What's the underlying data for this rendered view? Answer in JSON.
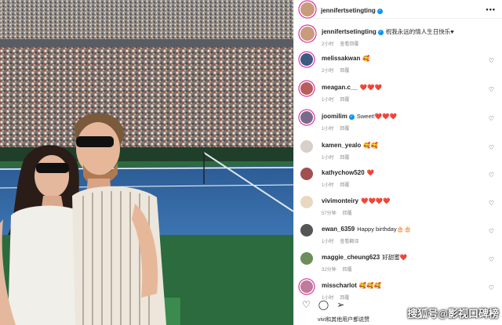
{
  "post": {
    "author": "jennifertsetingting",
    "caption": "祝我永远的情人生日快乐♥",
    "caption_time": "2小时",
    "caption_action": "查看回覆"
  },
  "comments": [
    {
      "user": "melissakwan",
      "text": "🥰",
      "time": "2小时",
      "reply": "回覆",
      "verified": false,
      "avatar_color": "#3d5a80"
    },
    {
      "user": "meagan.c__",
      "text": "❤️❤️❤️",
      "time": "1小时",
      "reply": "回覆",
      "verified": false,
      "avatar_color": "#b85c5c"
    },
    {
      "user": "joomilim",
      "text": "Sweet!❤️❤️❤️",
      "time": "1小时",
      "reply": "回覆",
      "verified": true,
      "avatar_color": "#7a6a8a"
    },
    {
      "user": "kamen_yealo",
      "text": "🥰🥰",
      "time": "1小时",
      "reply": "回覆",
      "verified": false,
      "avatar_color": "#d8d0c8"
    },
    {
      "user": "kathychow520",
      "text": "❤️",
      "time": "1小时",
      "reply": "回覆",
      "verified": false,
      "avatar_color": "#a05050"
    },
    {
      "user": "vivimonteiry",
      "text": "❤️❤️❤️❤️",
      "time": "57分钟",
      "reply": "回覆",
      "verified": false,
      "avatar_color": "#e8d8c0"
    },
    {
      "user": "ewan_6359",
      "text": "Happy birthday🎂🎂",
      "time": "1小时",
      "reply": "查看翻译",
      "verified": false,
      "avatar_color": "#555555"
    },
    {
      "user": "maggie_cheung623",
      "text": "好甜蜜❤️",
      "time": "32分钟",
      "reply": "回覆",
      "verified": false,
      "avatar_color": "#6b8e5a"
    },
    {
      "user": "misscharlot",
      "text": "🥰🥰🥰",
      "time": "1小时",
      "reply": "回覆",
      "verified": false,
      "avatar_color": "#c07a9a"
    }
  ],
  "actions": {
    "like_icon": "heart-outline-icon",
    "comment_icon": "comment-icon",
    "share_icon": "send-icon",
    "likes_text": "vivi和其他用户都说赞"
  },
  "watermark": "搜狐号@影视口碑榜",
  "colors": {
    "verified": "#0095f6",
    "story_ring": "#d6249f",
    "court": "#3a6d9a",
    "heart": "#ed4956"
  }
}
